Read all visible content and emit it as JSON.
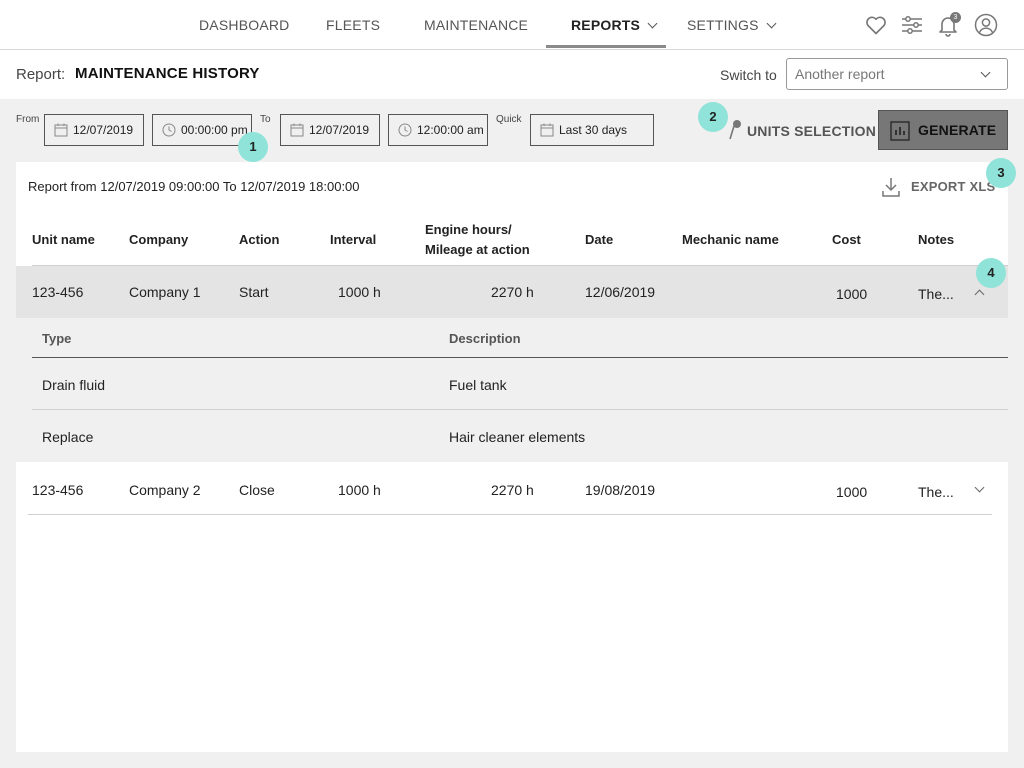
{
  "nav": {
    "items": [
      {
        "label": "DASHBOARD"
      },
      {
        "label": "FLEETS"
      },
      {
        "label": "MAINTENANCE"
      },
      {
        "label": "REPORTS"
      },
      {
        "label": "SETTINGS"
      }
    ],
    "notification_count": "3",
    "icons": [
      "heart-icon",
      "sliders-icon",
      "bell-icon",
      "user-icon"
    ]
  },
  "header": {
    "report_label": "Report:",
    "report_name": "MAINTENANCE HISTORY",
    "switch_label": "Switch to",
    "switch_placeholder": "Another report"
  },
  "filters": {
    "from_label": "From",
    "from_date": "12/07/2019",
    "from_time": "00:00:00 pm",
    "to_label": "To",
    "to_date": "12/07/2019",
    "to_time": "12:00:00 am",
    "quick_label": "Quick",
    "quick_value": "Last 30 days",
    "units_label": "UNITS SELECTION",
    "generate_label": "GENERATE"
  },
  "markers": [
    "1",
    "2",
    "3",
    "4"
  ],
  "report": {
    "range_text": "Report from 12/07/2019 09:00:00 To 12/07/2019 18:00:00",
    "export_label": "EXPORT XLS",
    "columns": {
      "unit": "Unit name",
      "company": "Company",
      "action": "Action",
      "interval": "Interval",
      "engine_line1": "Engine hours/",
      "engine_line2": "Mileage at action",
      "date": "Date",
      "mechanic": "Mechanic name",
      "cost": "Cost",
      "notes": "Notes"
    },
    "rows": [
      {
        "unit": "123-456",
        "company": "Company 1",
        "action": "Start",
        "interval": "1000 h",
        "engine": "2270 h",
        "date": "12/06/2019",
        "mechanic": "",
        "cost": "1000",
        "notes": "The..."
      },
      {
        "unit": "123-456",
        "company": "Company 2",
        "action": "Close",
        "interval": "1000 h",
        "engine": "2270 h",
        "date": "19/08/2019",
        "mechanic": "",
        "cost": "1000",
        "notes": "The..."
      }
    ],
    "detail": {
      "type_header": "Type",
      "description_header": "Description",
      "items": [
        {
          "type": "Drain fluid",
          "description": "Fuel tank"
        },
        {
          "type": "Replace",
          "description": "Hair cleaner elements"
        }
      ]
    }
  },
  "colors": {
    "marker": "#8fe3d8",
    "generate_bg": "#777777",
    "expanded_row": "#e4e4e4"
  }
}
